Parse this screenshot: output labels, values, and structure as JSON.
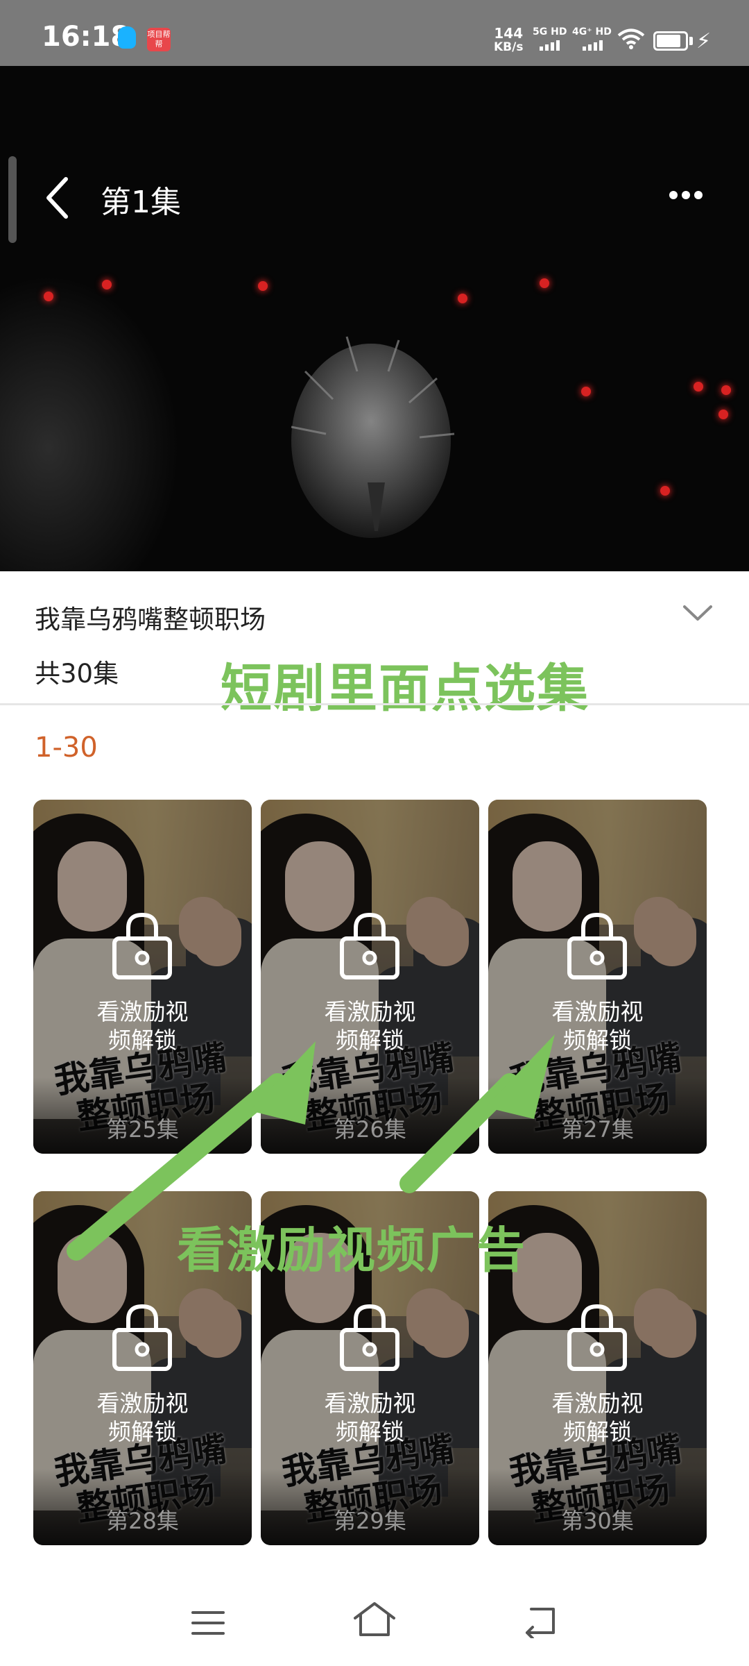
{
  "status_bar": {
    "time": "16:18",
    "app_badge": "项目帮帮",
    "net_speed_value": "144",
    "net_speed_unit": "KB/s",
    "sim1": "5G HD",
    "sim2": "4G⁺ HD"
  },
  "player": {
    "episode_title": "第1集"
  },
  "drama": {
    "title": "我靠乌鸦嘴整顿职场",
    "episode_count": "共30集",
    "range_tab": "1-30",
    "poster_calligraphy_line1": "我靠乌鸦嘴",
    "poster_calligraphy_line2": "整顿职场"
  },
  "annotations": {
    "select_episode": "短剧里面点选集",
    "watch_ad": "看激励视频广告",
    "arrow_color": "#7cc35c"
  },
  "episodes": [
    {
      "label": "第25集",
      "lock_text_1": "看激励视",
      "lock_text_2": "频解锁"
    },
    {
      "label": "第26集",
      "lock_text_1": "看激励视",
      "lock_text_2": "频解锁"
    },
    {
      "label": "第27集",
      "lock_text_1": "看激励视",
      "lock_text_2": "频解锁"
    },
    {
      "label": "第28集",
      "lock_text_1": "看激励视",
      "lock_text_2": "频解锁"
    },
    {
      "label": "第29集",
      "lock_text_1": "看激励视",
      "lock_text_2": "频解锁"
    },
    {
      "label": "第30集",
      "lock_text_1": "看激励视",
      "lock_text_2": "频解锁"
    }
  ],
  "icons": {
    "back": "chevron-left-icon",
    "more": "more-dots-icon",
    "expand": "chevron-down-icon",
    "lock": "lock-icon",
    "nav_menu": "menu-icon",
    "nav_home": "home-icon",
    "nav_back": "back-icon"
  },
  "colors": {
    "accent_range": "#d0622a",
    "annotation_green": "#7cc35c"
  }
}
